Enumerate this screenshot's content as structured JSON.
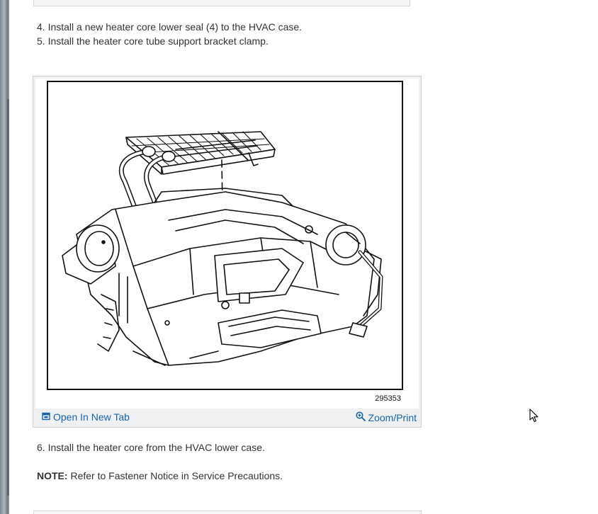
{
  "content": {
    "step4": "4. Install a new heater core lower seal (4) to the HVAC case.",
    "step5": "5. Install the heater core tube support bracket clamp.",
    "step6": "6. Install the heater core from the HVAC lower case.",
    "note_label": "NOTE:",
    "note_text": " Refer to Fastener Notice in Service Precautions."
  },
  "figure": {
    "number": "295353",
    "open_tab_label": "Open In New Tab",
    "zoom_label": "Zoom/Print",
    "icons": {
      "open": "open-new-tab-icon",
      "zoom": "zoom-in-icon"
    }
  },
  "colors": {
    "link": "#1a63a6",
    "text": "#333333"
  }
}
